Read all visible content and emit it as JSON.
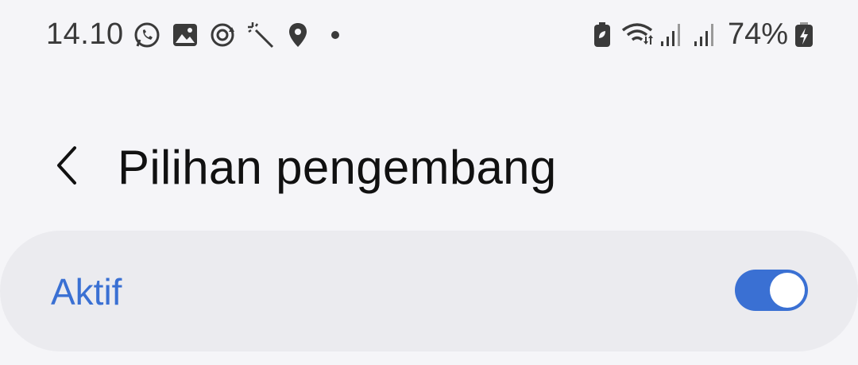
{
  "status_bar": {
    "time": "14.10",
    "battery_percent": "74%",
    "icons": [
      "whatsapp-icon",
      "gallery-icon",
      "sync-icon",
      "magic-wand-icon",
      "location-icon",
      "notification-dot-icon",
      "battery-saver-icon",
      "wifi-icon",
      "signal-icon",
      "signal-icon",
      "battery-charging-icon"
    ]
  },
  "header": {
    "title": "Pilihan pengembang",
    "back_icon": "chevron-left-icon"
  },
  "master_toggle": {
    "label": "Aktif",
    "state": "on",
    "accent_color": "#3a70d3"
  }
}
